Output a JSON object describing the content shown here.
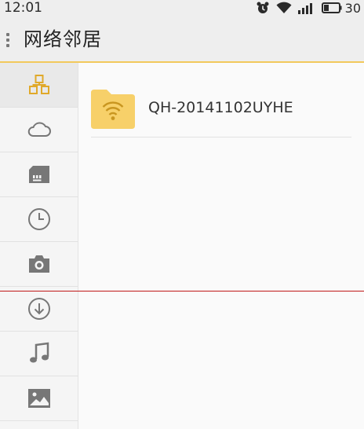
{
  "status_bar": {
    "time": "12:01",
    "battery": "30"
  },
  "header": {
    "title": "网络邻居"
  },
  "sidebar": {
    "items": [
      {
        "icon": "network-icon"
      },
      {
        "icon": "cloud-icon"
      },
      {
        "icon": "sd-card-icon"
      },
      {
        "icon": "clock-icon"
      },
      {
        "icon": "camera-icon"
      },
      {
        "icon": "download-icon"
      },
      {
        "icon": "music-icon"
      },
      {
        "icon": "image-icon"
      }
    ]
  },
  "files": [
    {
      "name": "QH-20141102UYHE",
      "icon": "wifi-folder-icon"
    }
  ],
  "colors": {
    "accent": "#f2c95c",
    "folder": "#f7d069",
    "icon": "#777777",
    "divider_red": "#c01818"
  }
}
